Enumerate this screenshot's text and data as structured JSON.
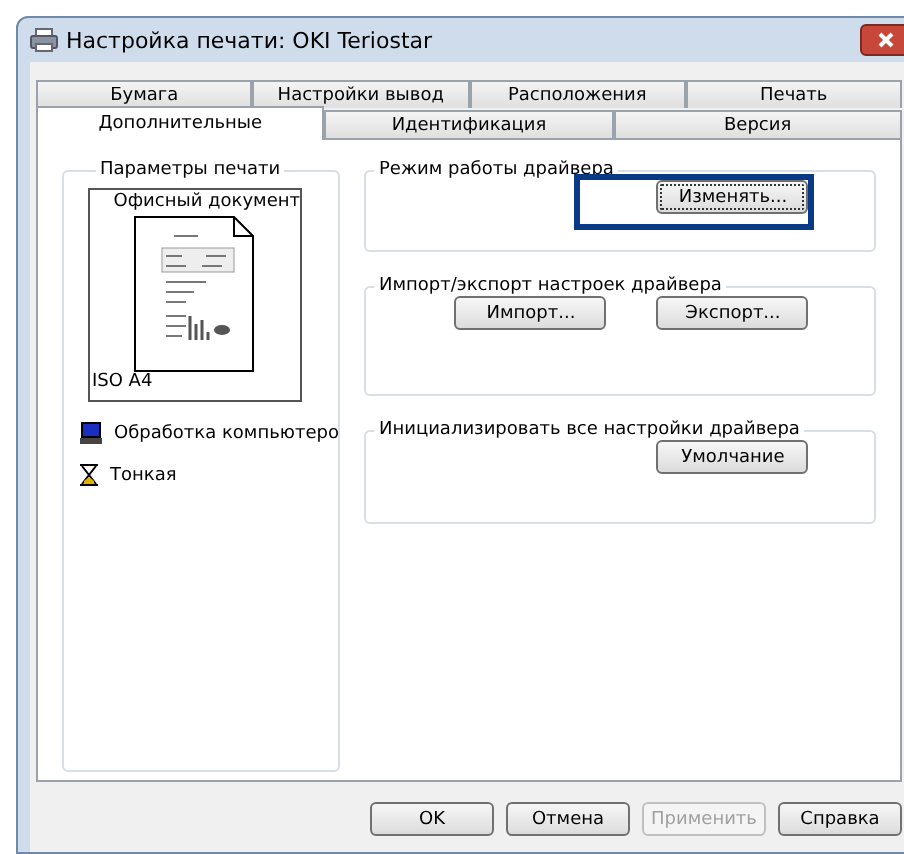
{
  "window": {
    "title": "Настройка печати: OKI Teriostar"
  },
  "tab_rows": [
    [
      {
        "label": "Бумага",
        "selected": false
      },
      {
        "label": "Настройки вывод",
        "selected": false
      },
      {
        "label": "Расположения",
        "selected": false
      },
      {
        "label": "Печать",
        "selected": false
      }
    ],
    [
      {
        "label": "Дополнительные",
        "selected": true
      },
      {
        "label": "Идентификация",
        "selected": false
      },
      {
        "label": "Версия",
        "selected": false
      }
    ]
  ],
  "print_settings": {
    "title": "Параметры печати",
    "preview_title": "Офисный документ",
    "paper_size": "ISO A4",
    "items": [
      {
        "kind": "computer",
        "label": "Обработка компьютеро"
      },
      {
        "kind": "hourglass",
        "label": "Тонкая"
      }
    ]
  },
  "groups": [
    {
      "title": "Режим работы драйвера",
      "buttons": [
        {
          "label": "Изменять...",
          "highlighted": true
        }
      ]
    },
    {
      "title": "Импорт/экспорт настроек драйвера",
      "buttons": [
        {
          "label": "Импорт...",
          "highlighted": false
        },
        {
          "label": "Экспорт...",
          "highlighted": false
        }
      ]
    },
    {
      "title": "Инициализировать все настройки драйвера",
      "buttons": [
        {
          "label": "Умолчание",
          "highlighted": false
        }
      ]
    }
  ],
  "buttons": [
    {
      "label": "OK",
      "disabled": false
    },
    {
      "label": "Отмена",
      "disabled": false
    },
    {
      "label": "Применить",
      "disabled": true
    },
    {
      "label": "Справка",
      "disabled": false
    }
  ]
}
